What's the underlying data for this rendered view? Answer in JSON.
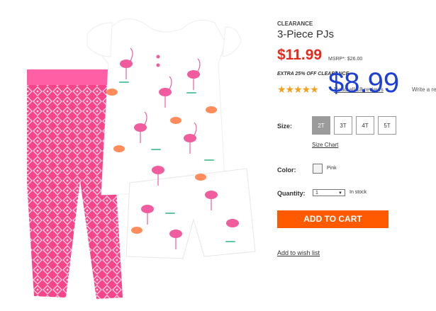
{
  "product": {
    "badge": "CLEARANCE",
    "title": "3-Piece PJs",
    "price": "$11.99",
    "msrp": "MSRP*: $26.00",
    "promo": "EXTRA 25% OFF CLEARANCE",
    "overlay_price": "$8.99",
    "rating": "★★★★★",
    "rating_value": 5,
    "reviews": "Read all 18 reviews",
    "write_review": "Write a review"
  },
  "size": {
    "label": "Size:",
    "options": [
      "2T",
      "3T",
      "4T",
      "5T"
    ],
    "selected": "2T",
    "chart_link": "Size Chart"
  },
  "color": {
    "label": "Color:",
    "name": "Pink",
    "swatch": "#f3f3f3"
  },
  "quantity": {
    "label": "Quantity:",
    "value": "1",
    "stock": "In stock"
  },
  "actions": {
    "add_to_cart": "ADD TO CART",
    "wishlist": "Add to wish list"
  },
  "colors": {
    "price_red": "#e32b1d",
    "cart_orange": "#ff5a00",
    "overlay_blue": "#1d3fd8",
    "star_gold": "#f3a01a"
  },
  "icons": {
    "dropdown": "chevron-down-icon",
    "rating": "star-icon"
  }
}
